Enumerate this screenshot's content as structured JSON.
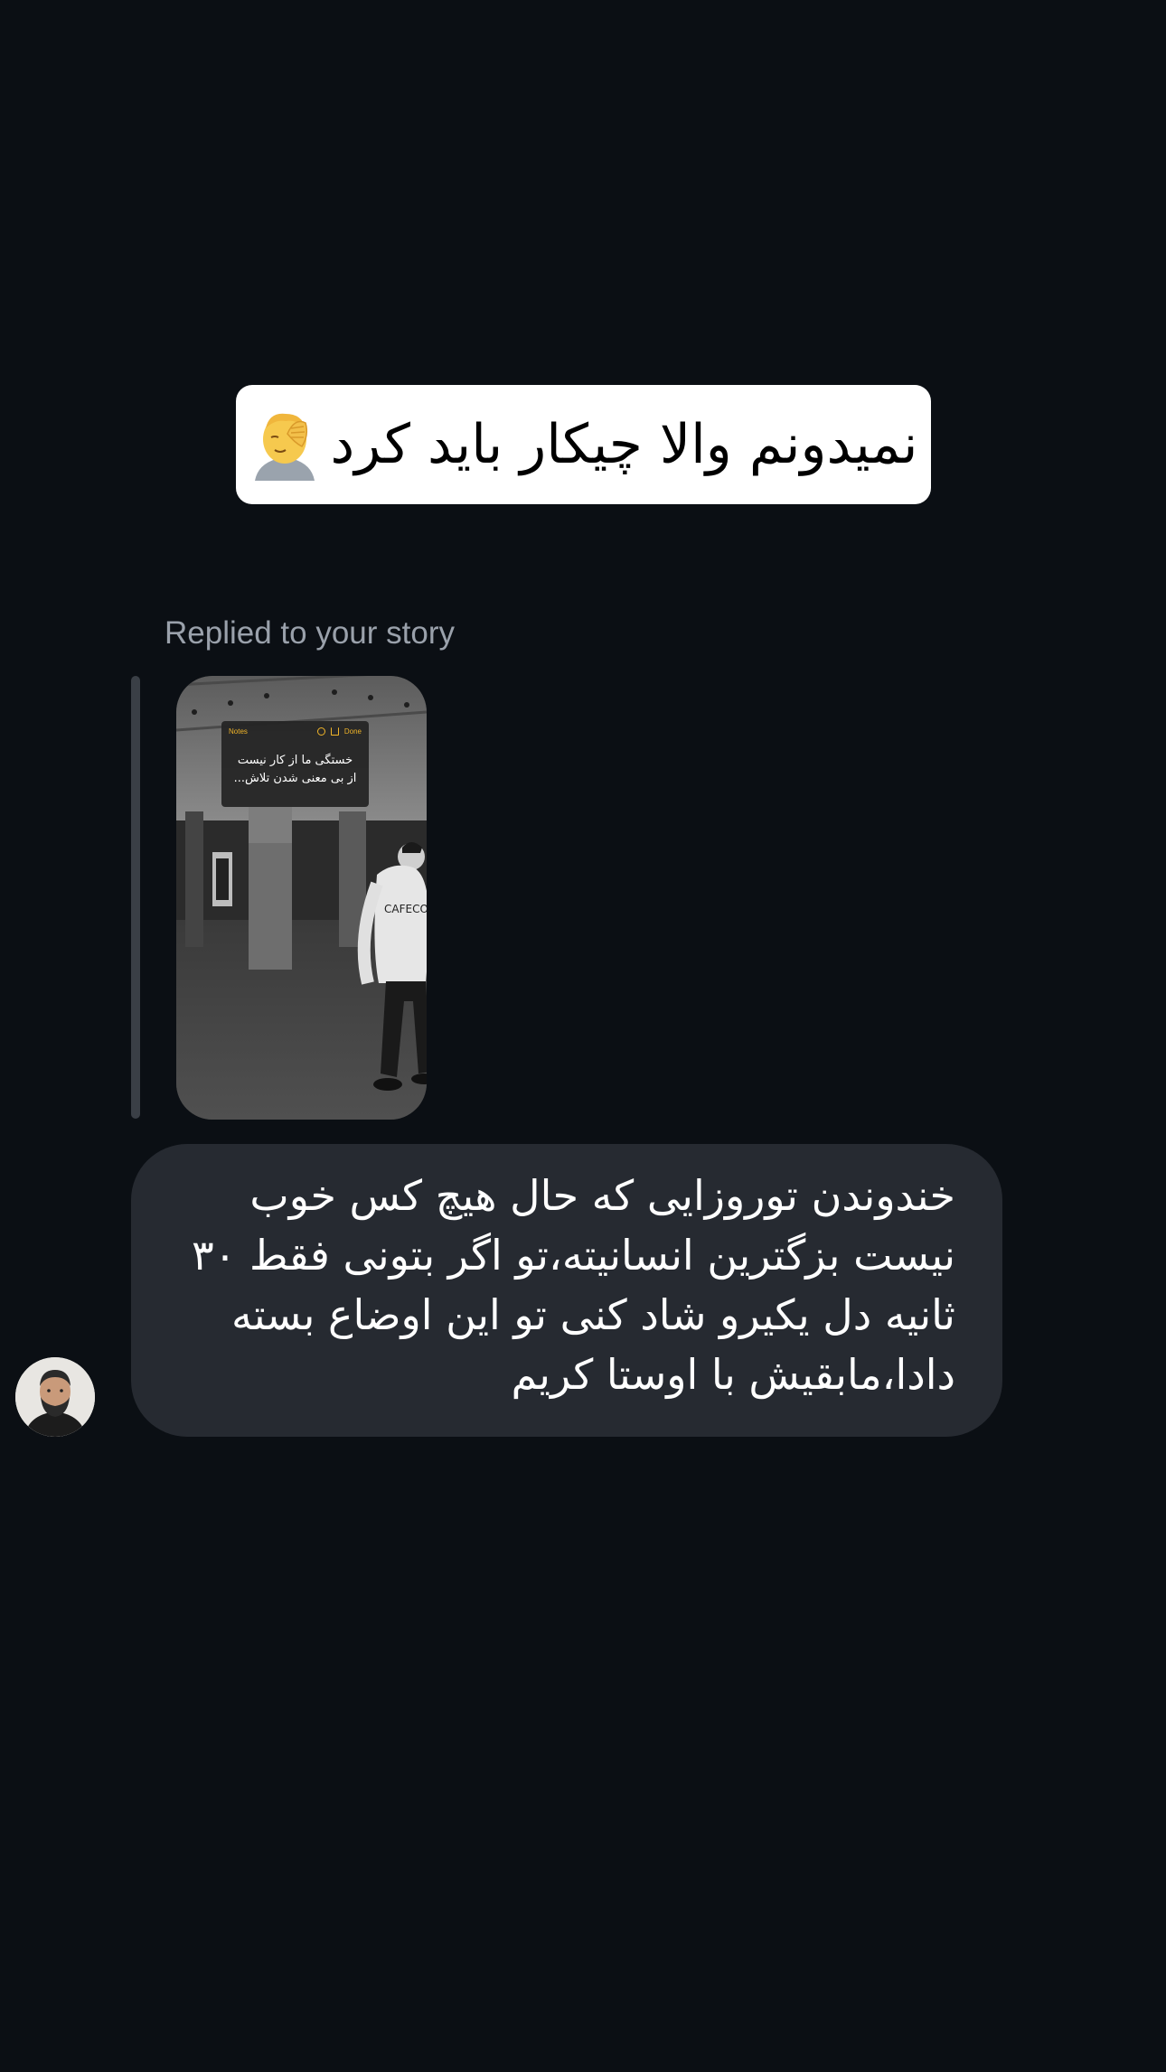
{
  "colors": {
    "background": "#0b0f14",
    "bubble": "#262a31",
    "reply_label": "#9aa1ab",
    "caption_bg": "#ffffff",
    "notes_accent": "#f0b429"
  },
  "caption": {
    "text": "نمیدونم والا چیکار باید کرد",
    "emoji_icon": "face-palm-emoji"
  },
  "reply": {
    "label": "Replied to your story"
  },
  "story": {
    "notes": {
      "back_label": "Notes",
      "done_label": "Done",
      "text": "خستگی ما از کار نیست\nاز بی معنی شدن تلاش..."
    },
    "sweatshirt_text": "CAFECODE"
  },
  "message": {
    "text": "خندوندن توروزایی که حال هیچ کس خوب نیست بزگترین انسانیته،تو اگر بتونی فقط ۳۰ ثانیه دل یکیرو شاد کنی  تو این اوضاع بسته دادا،مابقیش با اوستا کریم"
  },
  "sender": {
    "avatar_icon": "user-avatar"
  }
}
